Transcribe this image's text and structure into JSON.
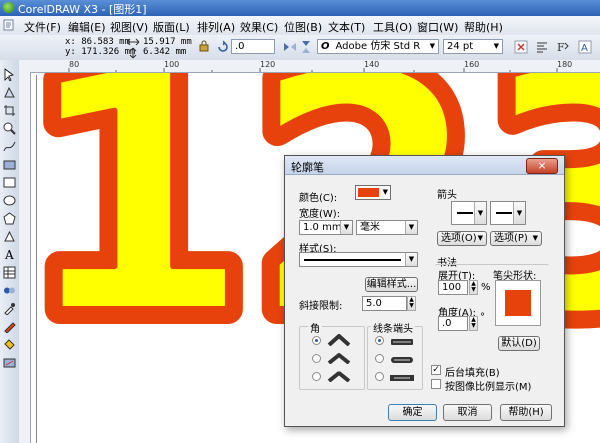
{
  "window": {
    "title": "CorelDRAW X3 - [图形1]"
  },
  "menu": [
    "文件(F)",
    "编辑(E)",
    "视图(V)",
    "版面(L)",
    "排列(A)",
    "效果(C)",
    "位图(B)",
    "文本(T)",
    "工具(O)",
    "窗口(W)",
    "帮助(H)"
  ],
  "property_bar": {
    "x": "x: 86.583 mm",
    "y": "y: 171.326 mm",
    "width": "15.917 mm",
    "height": "6.342 mm",
    "rotation": ".0",
    "font_name": "Adobe 仿宋 Std R",
    "font_size": "24 pt",
    "font_icon": "O"
  },
  "ruler": {
    "labels": [
      "80",
      "100",
      "120",
      "140",
      "160",
      "180"
    ]
  },
  "artwork": {
    "text": "123",
    "fill_color": "#ffff00",
    "outline_color": "#e8420c"
  },
  "dialog": {
    "title": "轮廓笔",
    "close": "×",
    "color_label": "颜色(C):",
    "color_value": "#e8420c",
    "width_label": "宽度(W):",
    "width_value": "1.0 mm",
    "unit_value": "毫米",
    "style_label": "样式(S):",
    "edit_style_button": "编辑样式...",
    "miter_label": "斜接限制:",
    "miter_value": "5.0",
    "corners_label": "角",
    "line_caps_label": "线条端头",
    "arrows_label": "箭头",
    "options_left": "选项(O)",
    "options_right": "选项(P)",
    "calligraphy_label": "书法",
    "stretch_label": "展开(T):",
    "stretch_value": "100",
    "stretch_unit": "%",
    "nib_shape_label": "笔尖形状:",
    "angle_label": "角度(A):",
    "angle_value": ".0",
    "angle_unit": "°",
    "default_button": "默认(D)",
    "behind_fill_label": "后台填充(B)",
    "behind_fill_checked": true,
    "scale_with_image_label": "按图像比例显示(M)",
    "scale_with_image_checked": false,
    "ok_button": "确定",
    "cancel_button": "取消",
    "help_button": "帮助(H)"
  }
}
